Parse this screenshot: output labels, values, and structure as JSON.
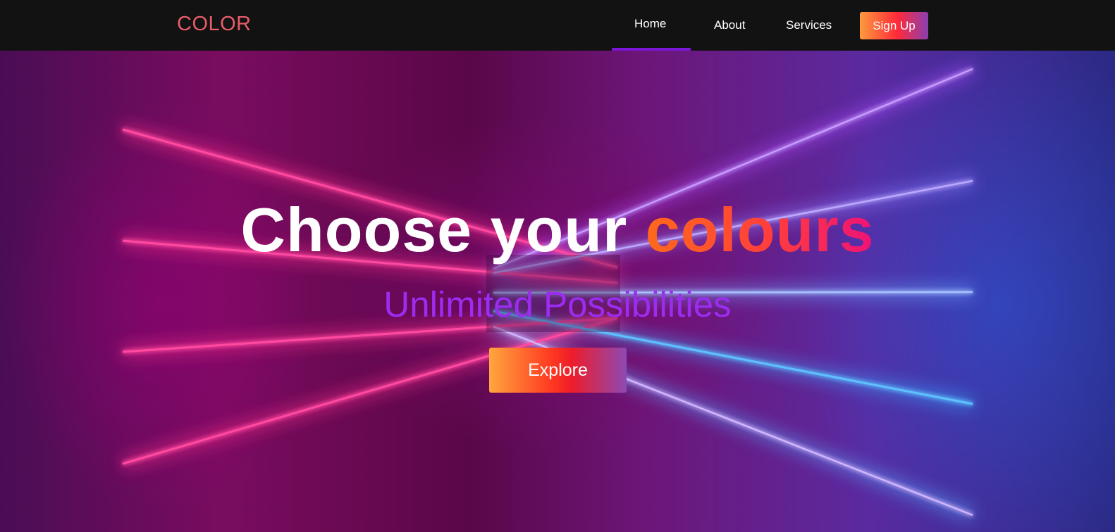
{
  "navbar": {
    "logo": "COLOR",
    "items": [
      {
        "label": "Home",
        "active": true
      },
      {
        "label": "About",
        "active": false
      },
      {
        "label": "Services",
        "active": false
      }
    ],
    "signup_label": "Sign Up",
    "active_indicator_color": "#7b16d6"
  },
  "hero": {
    "headline_prefix": "Choose your ",
    "headline_accent": "colours",
    "subtitle": "Unlimited Possibilities",
    "cta_label": "Explore"
  },
  "colors": {
    "logo": "#e85d6a",
    "subtitle": "#9b2cf0",
    "accent_gradient": [
      "#ff6a1a",
      "#ff3d3d",
      "#ee1277"
    ],
    "button_gradient": [
      "#ffa63e",
      "#ff3a22",
      "#8d4ab4"
    ],
    "neon_pink": "#ff2d8a",
    "neon_blue": "#3aa6ff"
  }
}
